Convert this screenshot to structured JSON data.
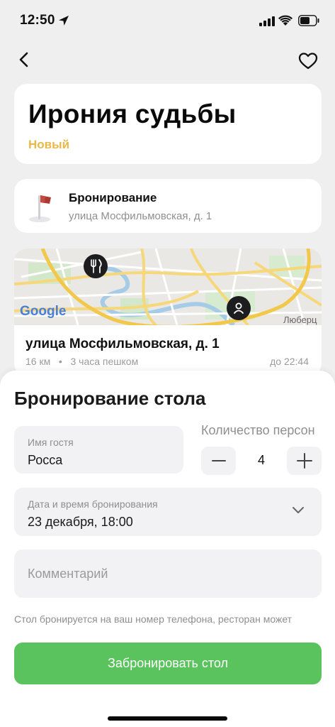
{
  "status_bar": {
    "time": "12:50"
  },
  "header": {
    "title": "Ирония судьбы",
    "badge": "Новый",
    "badge_color": "#e9b847"
  },
  "booking_card": {
    "title": "Бронирование",
    "address": "улица Мосфильмовская, д. 1",
    "icon": "flag-icon"
  },
  "map_card": {
    "map_logo": "Google",
    "map_label": "Люберц",
    "address": "улица Мосфильмовская, д. 1",
    "distance": "16 км",
    "walk_time": "3 часа пешком",
    "open_until": "до 22:44"
  },
  "sheet": {
    "title": "Бронирование стола",
    "guest": {
      "label": "Имя гостя",
      "value": "Росса"
    },
    "persons": {
      "label": "Количество персон",
      "value": "4"
    },
    "datetime": {
      "label": "Дата и время бронирования",
      "value": "23 декабря, 18:00"
    },
    "comment": {
      "placeholder": "Комментарий"
    },
    "note": "Стол бронируется на ваш номер телефона, ресторан может",
    "submit_label": "Забронировать стол",
    "accent_color": "#5ac35d"
  }
}
